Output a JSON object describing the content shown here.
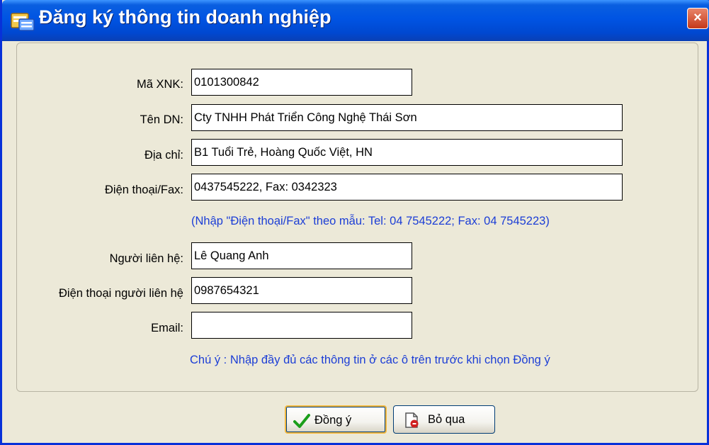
{
  "window": {
    "title": "Đăng ký thông tin doanh nghiệp",
    "app_icon": "form-window-icon",
    "close_icon": "close-icon",
    "close_label": "×"
  },
  "form": {
    "ma_xnk": {
      "label": "Mã XNK:",
      "value": "0101300842"
    },
    "ten_dn": {
      "label": "Tên DN:",
      "value": "Cty TNHH Phát Triển Công Nghệ Thái Sơn"
    },
    "dia_chi": {
      "label": "Địa chỉ:",
      "value": "B1 Tuổi Trẻ, Hoàng Quốc Việt, HN"
    },
    "dien_thoai_fax": {
      "label": "Điện thoại/Fax:",
      "value": "0437545222, Fax: 0342323"
    },
    "fax_hint": "(Nhập \"Điện thoại/Fax\" theo mẫu: Tel: 04 7545222; Fax: 04 7545223)",
    "nguoi_lien_he": {
      "label": "Người liên hệ:",
      "value": "Lê Quang Anh"
    },
    "dien_thoai_nguoi_lien_he": {
      "label": "Điện thoại người liên hệ",
      "value": "0987654321"
    },
    "email": {
      "label": "Email:",
      "value": ""
    },
    "note": "Chú ý : Nhập đầy đủ các thông tin ở các ô trên trước khi chọn Đồng ý"
  },
  "buttons": {
    "ok": {
      "label": "Đồng ý",
      "icon": "checkmark-icon"
    },
    "cancel": {
      "label": "Bỏ qua",
      "icon": "document-cancel-icon"
    }
  },
  "colors": {
    "titlebar": "#0054e3",
    "window_bg": "#ece9d8",
    "note_text": "#1c3ed6",
    "ok_icon": "#1a9e1a",
    "cancel_icon": "#d02020"
  }
}
